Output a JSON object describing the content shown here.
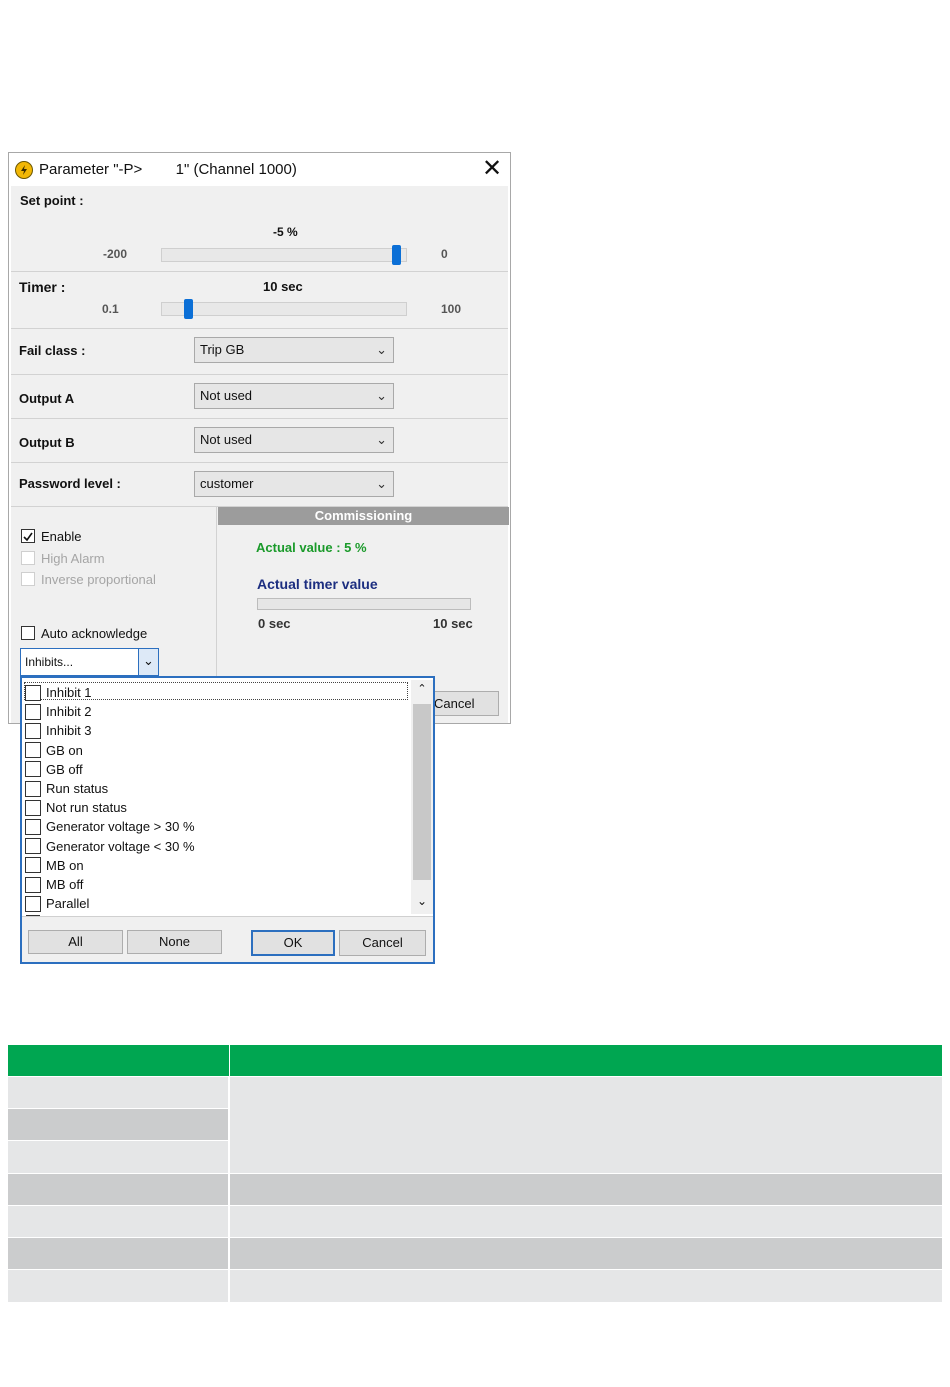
{
  "dialog": {
    "title": "Parameter \"-P>        1\" (Channel 1000)",
    "close_icon": "close-icon",
    "set_point": {
      "label": "Set point :",
      "value_text": "-5 %",
      "min_text": "-200",
      "max_text": "0",
      "value": -5,
      "min": -200,
      "max": 0
    },
    "timer": {
      "label": "Timer :",
      "value_text": "10 sec",
      "min_text": "0.1",
      "max_text": "100",
      "value": 10,
      "min": 0.1,
      "max": 100
    },
    "fail_class": {
      "label": "Fail class :",
      "value": "Trip GB"
    },
    "output_a": {
      "label": "Output A",
      "value": "Not used"
    },
    "output_b": {
      "label": "Output B",
      "value": "Not used"
    },
    "password_level": {
      "label": "Password level :",
      "value": "customer"
    },
    "checkboxes": {
      "enable": {
        "label": "Enable",
        "checked": true
      },
      "high_alarm": {
        "label": "High Alarm",
        "checked": false,
        "disabled": true
      },
      "inverse_proportional": {
        "label": "Inverse proportional",
        "checked": false,
        "disabled": true
      },
      "auto_acknowledge": {
        "label": "Auto acknowledge",
        "checked": false
      }
    },
    "inhibits_combo": {
      "value": "Inhibits..."
    },
    "commissioning": {
      "header": "Commissioning",
      "actual_value": "Actual value : 5 %",
      "actual_timer_label": "Actual timer value",
      "timer_min": "0 sec",
      "timer_max": "10 sec",
      "timer_progress": 0
    },
    "cancel_label": "Cancel"
  },
  "inhibit_list": {
    "items": [
      "Inhibit 1",
      "Inhibit 2",
      "Inhibit 3",
      "GB on",
      "GB off",
      "Run status",
      "Not run status",
      "Generator voltage > 30 %",
      "Generator voltage < 30 %",
      "MB on",
      "MB off",
      "Parallel"
    ],
    "buttons": {
      "all": "All",
      "none": "None",
      "ok": "OK",
      "cancel": "Cancel"
    }
  },
  "colors": {
    "accent_blue": "#0b6fd6",
    "green_text": "#1a9a2a",
    "navy_text": "#1c2e80",
    "commissioning_header": "#9c9c9c",
    "table_header": "#00a651",
    "row_light": "#e5e6e7",
    "row_dark": "#cbcccd"
  },
  "table": {
    "header": [
      "",
      ""
    ],
    "rows": 7
  }
}
